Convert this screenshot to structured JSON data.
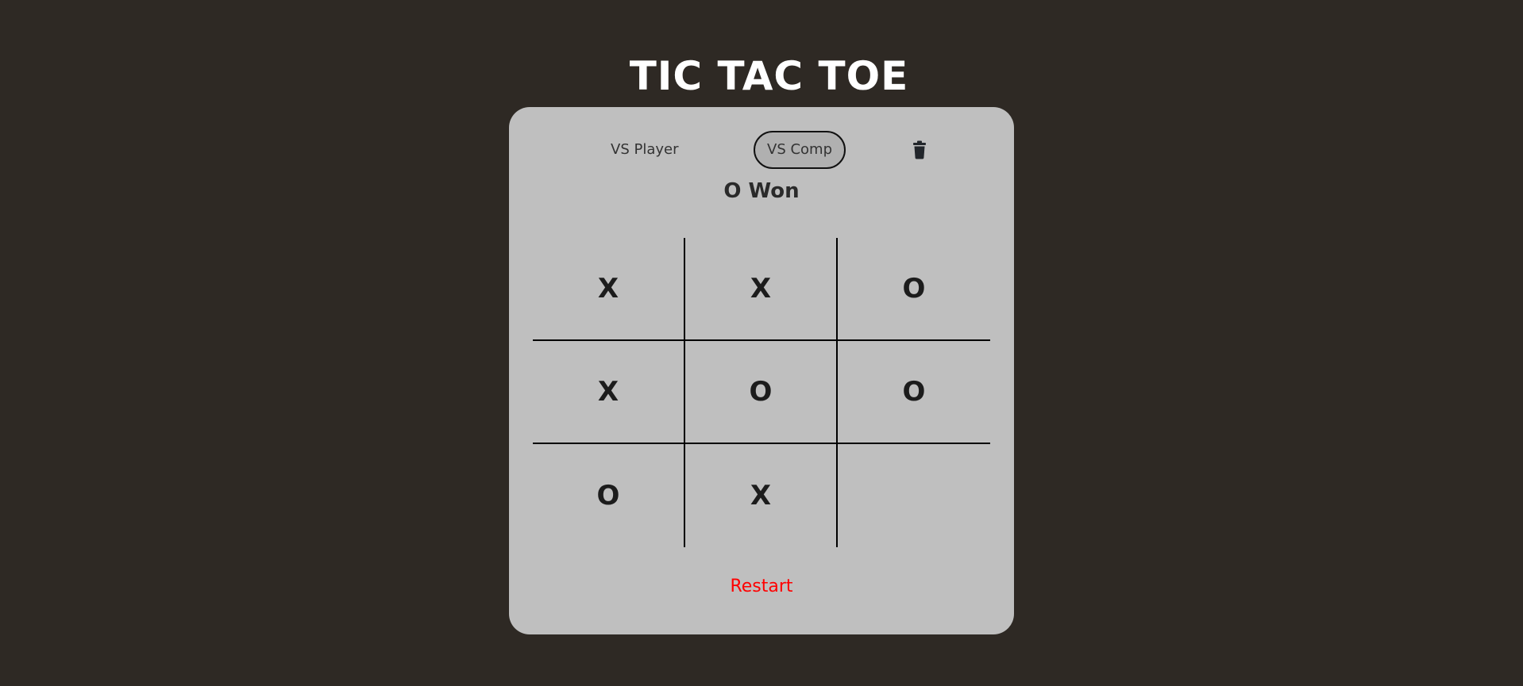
{
  "title": "TIC TAC TOE",
  "modes": {
    "player_label": "VS Player",
    "comp_label": "VS Comp",
    "selected": "VS Comp"
  },
  "clear_icon": "trash-icon",
  "status": "O Won",
  "board": {
    "cells": [
      "X",
      "X",
      "O",
      "X",
      "O",
      "O",
      "O",
      "X",
      ""
    ]
  },
  "restart_label": "Restart",
  "colors": {
    "background": "#2e2924",
    "card": "#bfbfbf",
    "restart": "#ff0000",
    "title": "#ffffff"
  }
}
